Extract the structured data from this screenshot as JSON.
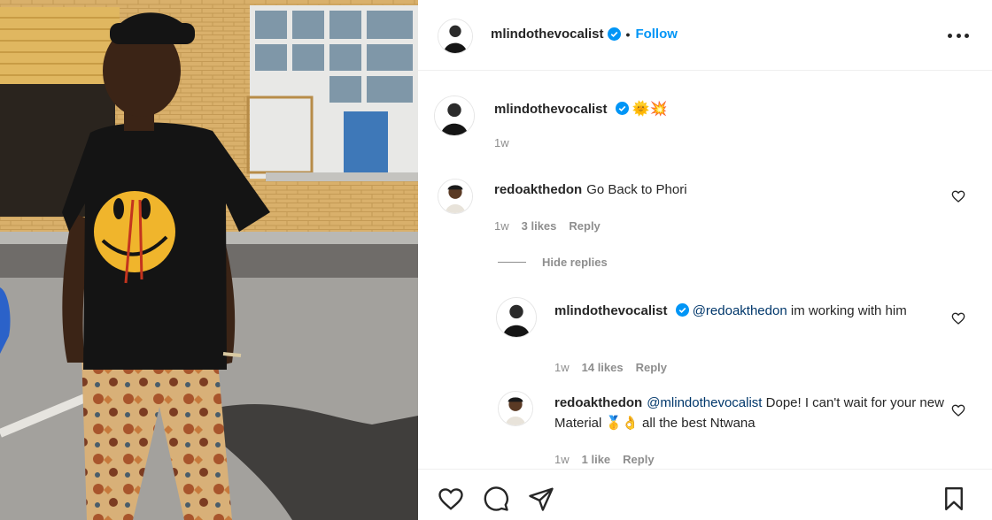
{
  "post": {
    "author": "mlindothevocalist",
    "follow_label": "Follow",
    "separator": "•",
    "caption_emoji": "🌞💥",
    "caption_time": "1w"
  },
  "comments": [
    {
      "user": "redoakthedon",
      "text": "Go Back to Phori",
      "time": "1w",
      "likes": "3 likes",
      "reply_label": "Reply"
    }
  ],
  "hide_replies_label": "Hide replies",
  "replies": [
    {
      "user": "mlindothevocalist",
      "mention": "@redoakthedon",
      "text": " im working with him",
      "time": "1w",
      "likes": "14 likes",
      "reply_label": "Reply"
    },
    {
      "user": "redoakthedon",
      "mention": "@mlindothevocalist",
      "text": " Dope! I can't wait for your new Material 🥇👌 all the best Ntwana",
      "time": "1w",
      "likes": "1 like",
      "reply_label": "Reply"
    }
  ],
  "icons": {
    "verified": "verified-badge-icon",
    "more": "more-options-icon",
    "like": "heart-icon",
    "comment": "comment-icon",
    "share": "share-icon",
    "save": "bookmark-icon"
  },
  "colors": {
    "accent": "#0095f6",
    "mention": "#00376b",
    "muted": "#8e8e8e"
  }
}
